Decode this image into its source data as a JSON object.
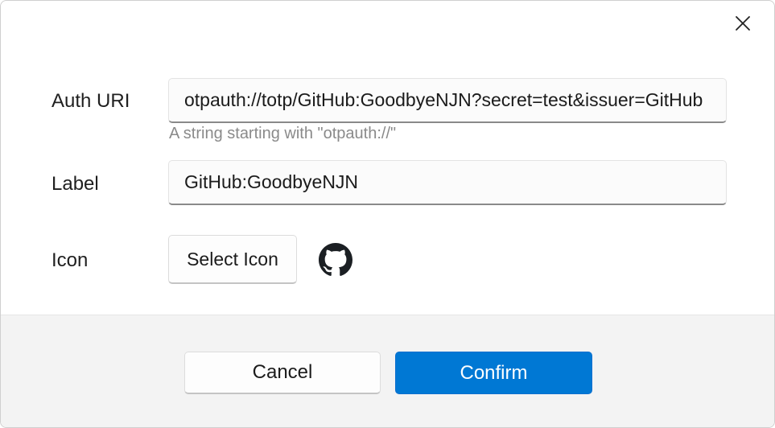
{
  "dialog": {
    "close_icon": "close-icon"
  },
  "form": {
    "auth_uri": {
      "label": "Auth URI",
      "value": "otpauth://totp/GitHub:GoodbyeNJN?secret=test&issuer=GitHub",
      "hint": "A string starting with \"otpauth://\""
    },
    "label": {
      "label": "Label",
      "value": "GitHub:GoodbyeNJN"
    },
    "icon": {
      "label": "Icon",
      "select_button": "Select Icon",
      "current_icon": "github-icon"
    }
  },
  "footer": {
    "cancel_label": "Cancel",
    "confirm_label": "Confirm"
  },
  "colors": {
    "accent": "#0078d4",
    "footer_background": "#f3f3f3"
  }
}
